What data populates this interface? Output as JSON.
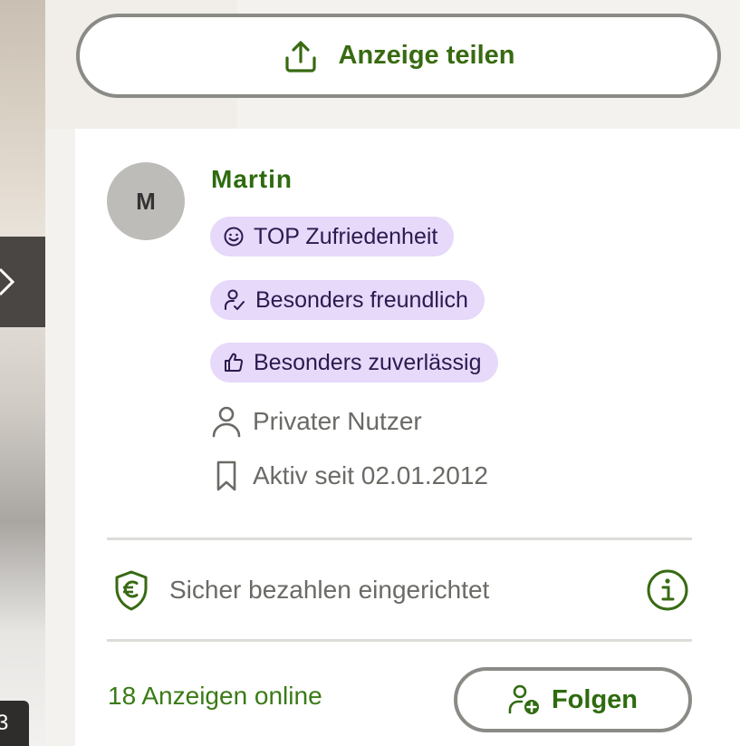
{
  "photo": {
    "counter_text": "3"
  },
  "share": {
    "label": "Anzeige teilen",
    "icon": "share-upload-icon"
  },
  "seller": {
    "avatar_initial": "M",
    "name": "Martin",
    "badges": [
      {
        "label": "TOP Zufriedenheit",
        "icon": "smiley-icon"
      },
      {
        "label": "Besonders freundlich",
        "icon": "friendly-user-icon"
      },
      {
        "label": "Besonders zuverlässig",
        "icon": "thumbs-up-icon"
      }
    ],
    "user_type": "Privater Nutzer",
    "active_since": "Aktiv seit 02.01.2012"
  },
  "secure_payment": {
    "label": "Sicher bezahlen eingerichtet",
    "icon": "euro-shield-icon",
    "info_icon": "info-icon"
  },
  "footer": {
    "ads_online": "18 Anzeigen online",
    "follow_label": "Folgen",
    "follow_icon": "add-user-icon"
  },
  "colors": {
    "brand_green": "#386a12",
    "badge_bg": "#e6d9fa",
    "badge_text": "#2b1a4e",
    "muted_text": "#6a6a66",
    "border_gray": "#8a8a86"
  }
}
